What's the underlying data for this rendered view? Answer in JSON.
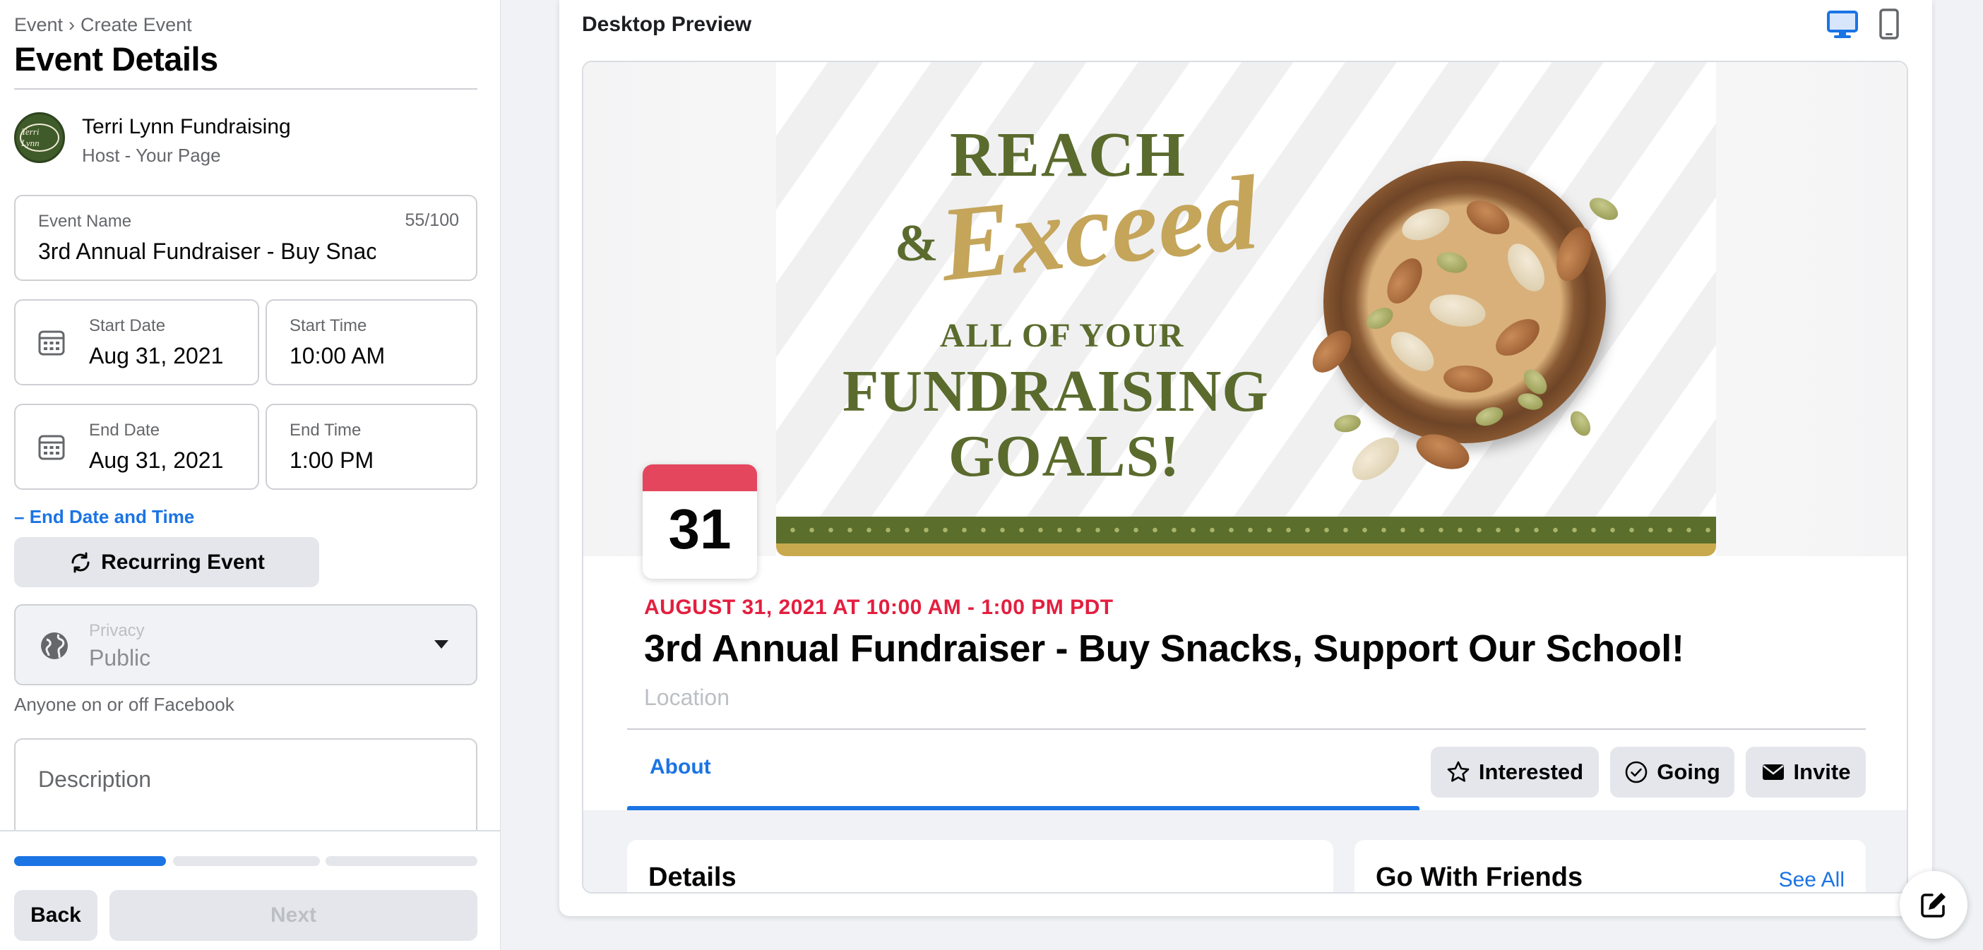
{
  "breadcrumb": {
    "parent": "Event",
    "separator": "›",
    "current": "Create Event"
  },
  "page_title": "Event Details",
  "host": {
    "name": "Terri Lynn Fundraising",
    "subtitle": "Host - Your Page",
    "avatar_text": "Terri Lynn"
  },
  "event_name": {
    "label": "Event Name",
    "value": "3rd Annual Fundraiser - Buy Snac",
    "counter": "55/100"
  },
  "start": {
    "date_label": "Start Date",
    "date_value": "Aug 31, 2021",
    "time_label": "Start Time",
    "time_value": "10:00 AM"
  },
  "end": {
    "date_label": "End Date",
    "date_value": "Aug 31, 2021",
    "time_label": "End Time",
    "time_value": "1:00 PM"
  },
  "end_toggle": {
    "icon": "–",
    "label": "End Date and Time"
  },
  "recurring_label": "Recurring Event",
  "privacy": {
    "label": "Privacy",
    "value": "Public",
    "note": "Anyone on or off Facebook"
  },
  "description_placeholder": "Description",
  "progress": {
    "steps": 3,
    "current_step": 1
  },
  "nav": {
    "back": "Back",
    "next": "Next"
  },
  "preview": {
    "label": "Desktop Preview",
    "cover_text": {
      "line1": "REACH",
      "amp": "&",
      "script": "Exceed",
      "line3": "ALL OF YOUR",
      "line4": "FUNDRAISING",
      "line5": "GOALS!"
    },
    "calendar_day": "31",
    "date_line": "AUGUST 31, 2021 AT 10:00 AM - 1:00 PM PDT",
    "title": "3rd Annual Fundraiser - Buy Snacks, Support Our School!",
    "location_placeholder": "Location",
    "tab_about": "About",
    "buttons": {
      "interested": "Interested",
      "going": "Going",
      "invite": "Invite"
    },
    "details_heading": "Details",
    "friends_heading": "Go With Friends",
    "see_all": "See All"
  },
  "colors": {
    "accent": "#1b74e4",
    "date_red": "#e41e3f",
    "calendar_red": "#e4475d",
    "cover_green": "#5a6b2d",
    "cover_gold": "#c4a55a"
  }
}
